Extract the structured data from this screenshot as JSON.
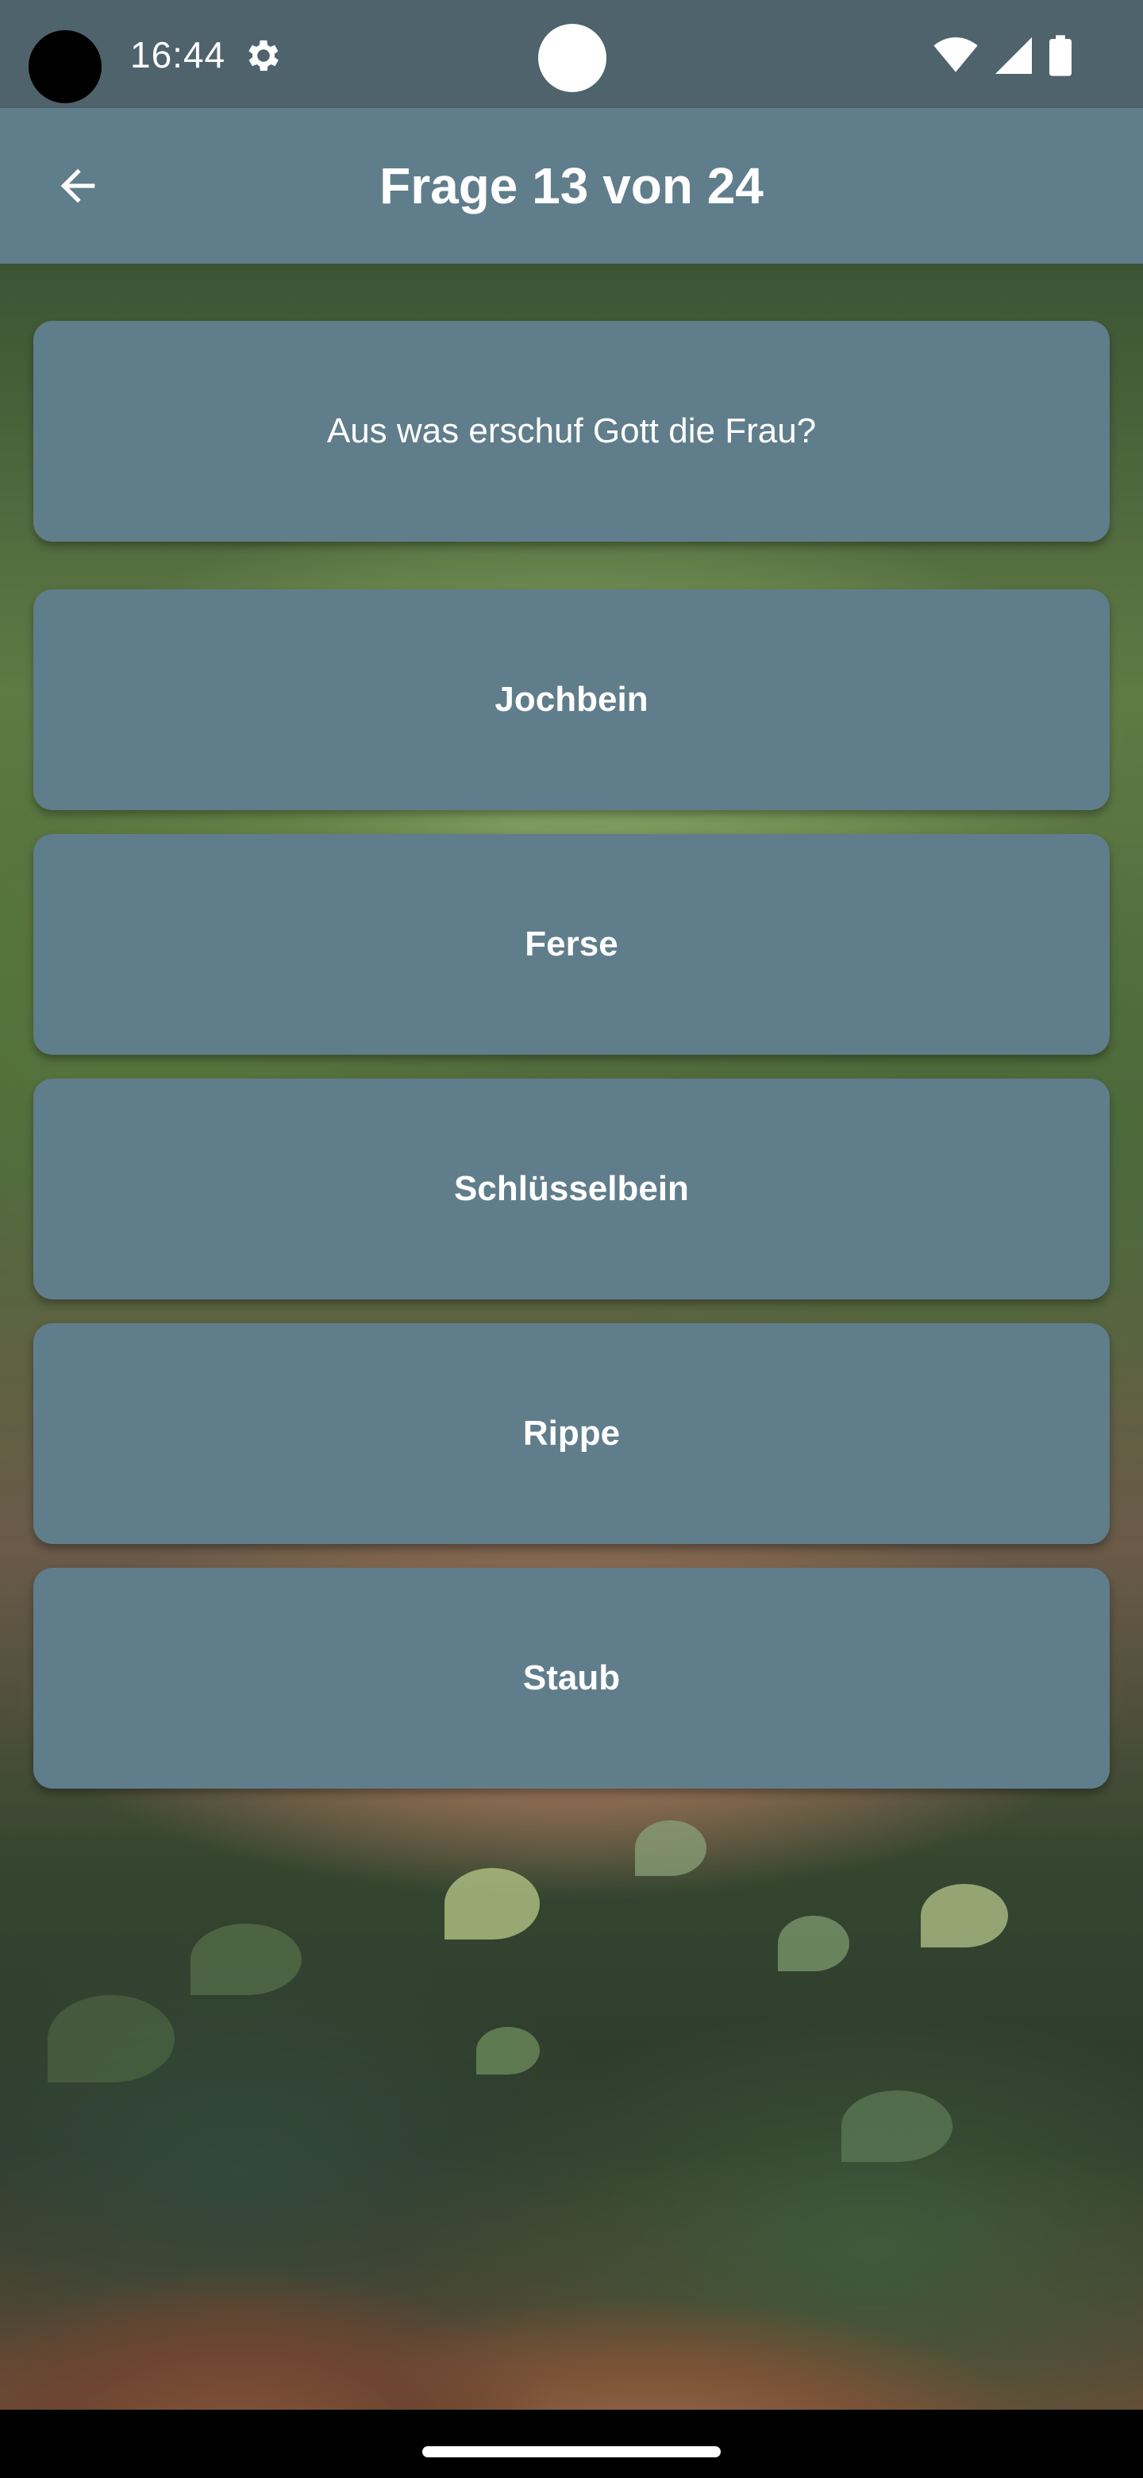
{
  "status_bar": {
    "time": "16:44",
    "icons": [
      "gear-icon",
      "wifi-icon",
      "signal-icon",
      "battery-icon"
    ]
  },
  "app_bar": {
    "title": "Frage 13 von 24",
    "back_icon": "arrow-left-icon"
  },
  "quiz": {
    "question": "Aus was erschuf Gott die Frau?",
    "answers": [
      {
        "label": "Jochbein"
      },
      {
        "label": "Ferse"
      },
      {
        "label": "Schlüsselbein"
      },
      {
        "label": "Rippe"
      },
      {
        "label": "Staub"
      }
    ]
  },
  "colors": {
    "status_bar": "#4f636c",
    "app_bar": "#607d8b",
    "card": "#607d8b",
    "text": "#ffffff"
  }
}
